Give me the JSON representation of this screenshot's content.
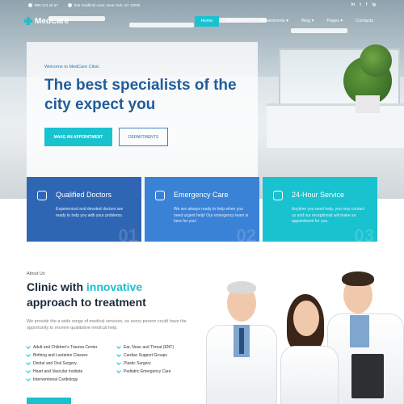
{
  "topbar": {
    "phone": "880 123 45 67",
    "address": "815 Goldfield Lane, New York, NY 10025",
    "social": [
      "in",
      "t",
      "f",
      "ig"
    ]
  },
  "nav": {
    "brand": "MedCare",
    "items": [
      {
        "label": "Home",
        "active": true
      },
      {
        "label": "About us",
        "active": false
      },
      {
        "label": "Departments",
        "active": false
      },
      {
        "label": "Blog",
        "active": false
      },
      {
        "label": "Pages",
        "active": false
      },
      {
        "label": "Contacts",
        "active": false
      }
    ]
  },
  "hero": {
    "welcome": "Welcome to MedCare Clinic",
    "title": "The best specialists of the city expect you",
    "primary_button": "MAKE AN APPOINTMENT",
    "secondary_button": "DEPARTMENTS"
  },
  "cards": [
    {
      "title": "Qualified Doctors",
      "text": "Experienced and devoted doctors are ready to help you with your problems.",
      "num": "01",
      "icon": "doctor-icon"
    },
    {
      "title": "Emergency Care",
      "text": "We are always ready to help when you need urgent help! Our emergency team is here for you!",
      "num": "02",
      "icon": "ambulance-icon"
    },
    {
      "title": "24-Hour Service",
      "text": "Anytime you need help, you may contact us and our receptionist will make an appointment for you.",
      "num": "03",
      "icon": "hospital-icon"
    }
  ],
  "about": {
    "label": "About Us",
    "title_part1": "Clinic with ",
    "title_highlight": "innovative",
    "title_part2": "approach to treatment",
    "text": "We provide the a wide range of medical services, so every person could have the opportunity to receive qualitative medical help.",
    "services": [
      "Adult and Children's Trauma Center",
      "Ear, Nose and Throat (ENT)",
      "Birthing and Lactation Classes",
      "Cardiac Support Groups",
      "Dental and Oral Surgery",
      "Plastic Surgery",
      "Heart and Vascular Institute",
      "Pediatric Emergency Care",
      "Interventional Cardiology"
    ]
  },
  "colors": {
    "accent": "#18c2cf",
    "primary": "#1f5d9a",
    "card1": "#2f66b3",
    "card2": "#3a82d6",
    "card3": "#18c2cf"
  }
}
